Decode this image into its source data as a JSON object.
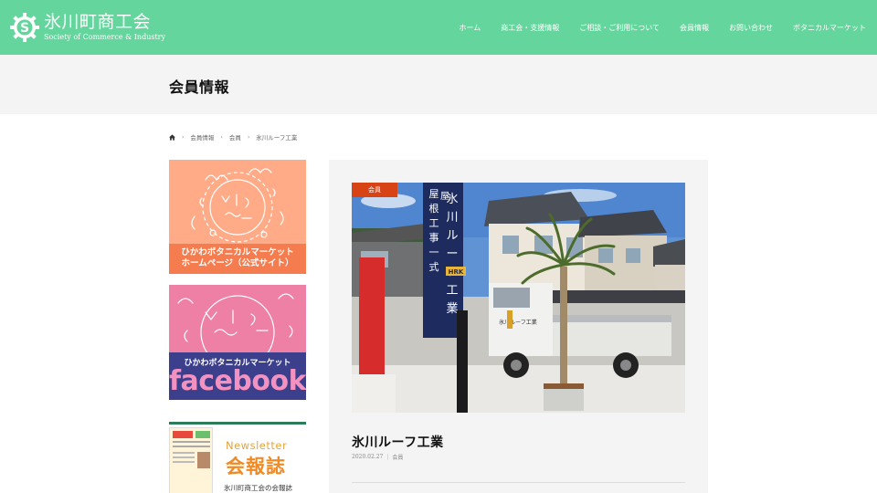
{
  "header": {
    "logo_title": "氷川町商工会",
    "logo_subtitle": "Society of Commerce & Industry",
    "nav": [
      {
        "label": "ホーム"
      },
      {
        "label": "商工会・支援情報"
      },
      {
        "label": "ご相談・ご利用について"
      },
      {
        "label": "会員情報"
      },
      {
        "label": "お問い合わせ"
      },
      {
        "label": "ボタニカルマーケット"
      }
    ],
    "bg_color": "#64d59c"
  },
  "page_title": "会員情報",
  "breadcrumb": {
    "home_icon": "home-icon",
    "items": [
      "会員情報",
      "会員",
      "氷川ルーフ工業"
    ]
  },
  "sidebar": {
    "banner1": {
      "line1": "ひかわボタニカルマーケット",
      "line2": "ホームページ（公式サイト）"
    },
    "banner2": {
      "label": "ひかわボタニカルマーケット",
      "brand": "facebook"
    },
    "newsletter": {
      "en": "Newsletter",
      "jp": "会報誌",
      "desc": "氷川町商工会の会報誌"
    }
  },
  "post": {
    "category": "会員",
    "title": "氷川ルーフ工業",
    "date": "2020.02.27",
    "meta_category": "会員",
    "photo": {
      "banner_text": "屋根工事一式",
      "banner_text2": "氷川ルーフ工業",
      "banner_logo": "HRK",
      "truck_text": "氷川ルーフ工業"
    }
  },
  "colors": {
    "accent": "#64d59c",
    "badge": "#d84315",
    "banner_orange": "#f47c4e",
    "banner_pink": "#ee7fa5",
    "banner_navy": "#3b3f8c"
  }
}
